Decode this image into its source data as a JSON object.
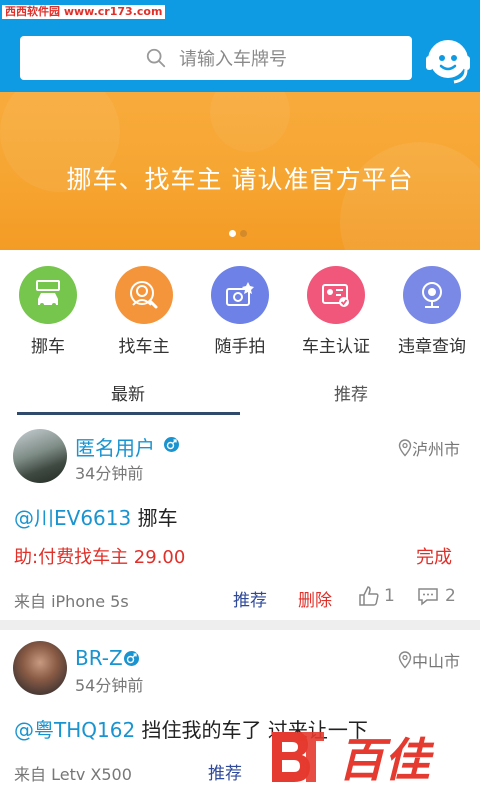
{
  "watermark_top": "西西软件园 www.cr173.com",
  "search": {
    "placeholder": "请输入车牌号"
  },
  "banner": {
    "text": "挪车、找车主   请认准官方平台",
    "slide_count": 2,
    "active_slide": 1
  },
  "quick_actions": [
    {
      "label": "挪车",
      "icon": "car-sign-icon",
      "color": "#76c54d"
    },
    {
      "label": "找车主",
      "icon": "find-owner-icon",
      "color": "#f5953b"
    },
    {
      "label": "随手拍",
      "icon": "camera-icon",
      "color": "#6d81e6"
    },
    {
      "label": "车主认证",
      "icon": "id-card-icon",
      "color": "#f0577a"
    },
    {
      "label": "违章查询",
      "icon": "webcam-icon",
      "color": "#7a89e6"
    }
  ],
  "tabs": [
    {
      "label": "最新",
      "active": true
    },
    {
      "label": "推荐",
      "active": false
    }
  ],
  "posts": [
    {
      "username": "匿名用户",
      "time": "34分钟前",
      "location": "泸州市",
      "plate": "@川EV6613",
      "text": "挪车",
      "fee_text": "助:付费找车主 29.00",
      "status": "完成",
      "from": "来自  iPhone 5s",
      "recommend": "推荐",
      "delete": "删除",
      "likes": "1",
      "comments": "2"
    },
    {
      "username": "BR-Z",
      "time": "54分钟前",
      "location": "中山市",
      "plate": "@粤THQ162",
      "text": "挡住我的车了 过来让一下",
      "from": "来自  Letv X500",
      "recommend": "推荐"
    }
  ],
  "watermark_logo": "百佳",
  "colors": {
    "primary": "#0e9be3",
    "banner": "#f6a531",
    "accent_red": "#e0302a",
    "link": "#1a94d0",
    "action_blue": "#2f4a9b"
  }
}
